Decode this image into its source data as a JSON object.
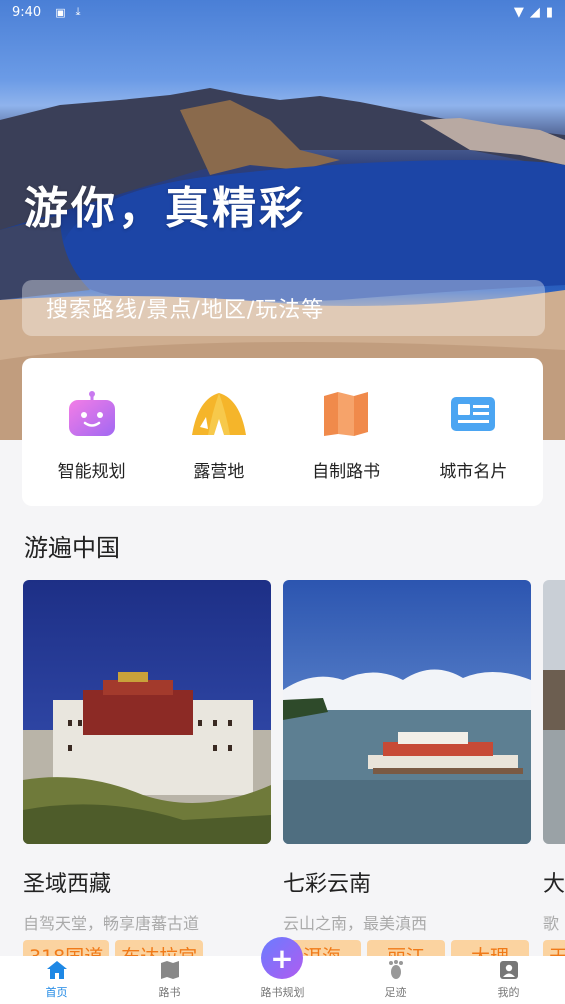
{
  "status_bar": {
    "time": "9:40"
  },
  "hero": {
    "title": "游你，真精彩"
  },
  "search": {
    "placeholder": "搜索路线/景点/地区/玩法等"
  },
  "quick_actions": [
    {
      "label": "智能规划",
      "icon": "robot-icon"
    },
    {
      "label": "露营地",
      "icon": "tent-icon"
    },
    {
      "label": "自制路书",
      "icon": "map-book-icon"
    },
    {
      "label": "城市名片",
      "icon": "city-card-icon"
    }
  ],
  "section": {
    "title": "游遍中国"
  },
  "cards": [
    {
      "title": "圣域西藏",
      "subtitle": "自驾天堂，畅享唐蕃古道",
      "tags": [
        "318国道",
        "布达拉宫"
      ]
    },
    {
      "title": "七彩云南",
      "subtitle": "云山之南，最美滇西",
      "tags": [
        "洱海",
        "丽江",
        "大理"
      ]
    },
    {
      "title": "大",
      "subtitle": "歌",
      "tags": [
        "天"
      ]
    }
  ],
  "nav": {
    "items": [
      {
        "label": "首页",
        "icon": "home-icon",
        "active": true
      },
      {
        "label": "路书",
        "icon": "map-icon"
      },
      {
        "label": "路书规划",
        "icon": "plus-icon"
      },
      {
        "label": "足迹",
        "icon": "footprint-icon"
      },
      {
        "label": "我的",
        "icon": "profile-icon"
      }
    ]
  },
  "colors": {
    "accent": "#1e88e5",
    "tag_bg": "#fbd3a0",
    "tag_text": "#f07a18"
  }
}
